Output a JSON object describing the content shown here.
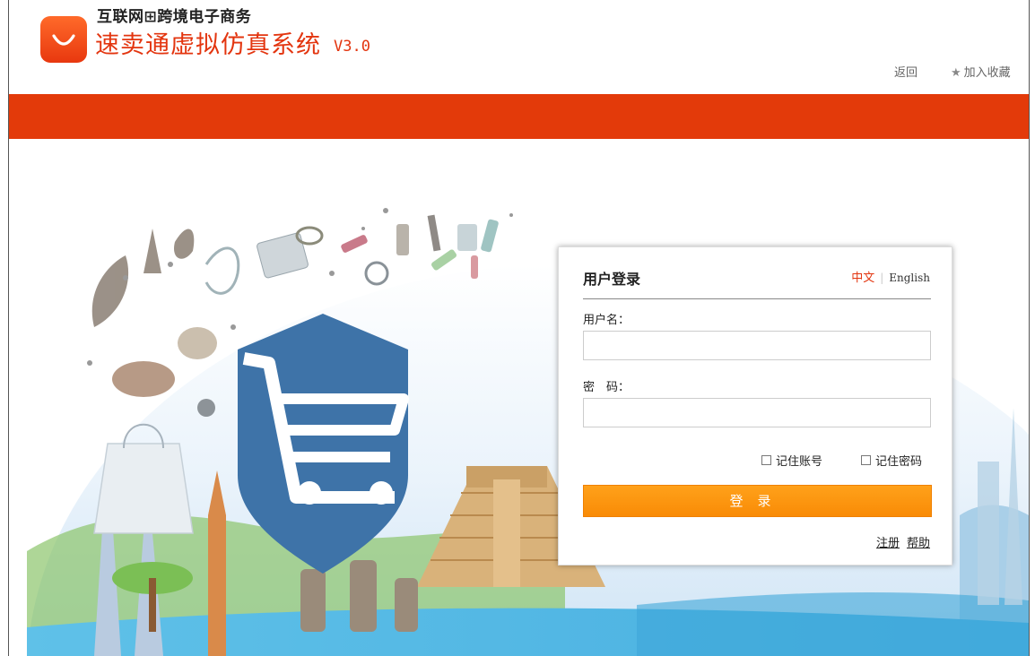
{
  "header": {
    "brand_top": "互联网⊞跨境电子商务",
    "brand_main": "速卖通虚拟仿真系统",
    "version": "V3.0",
    "back_link": "返回",
    "favorite_link": "加入收藏"
  },
  "login": {
    "title": "用户登录",
    "lang_cn": "中文",
    "lang_separator": "|",
    "lang_en": "English",
    "username_label": "用户名：",
    "username_value": "",
    "password_label": "密　码：",
    "password_value": "",
    "remember_account": "记住账号",
    "remember_password": "记住密码",
    "submit": "登录",
    "register": "注册",
    "help": "帮助"
  },
  "colors": {
    "brand_red": "#e3350f",
    "band_red": "#e33a0a",
    "button_orange": "#f98b06",
    "shield_blue": "#3e73a8"
  },
  "icons": [
    "shopping-bag-logo-icon",
    "star-icon",
    "cart-shield-icon"
  ]
}
